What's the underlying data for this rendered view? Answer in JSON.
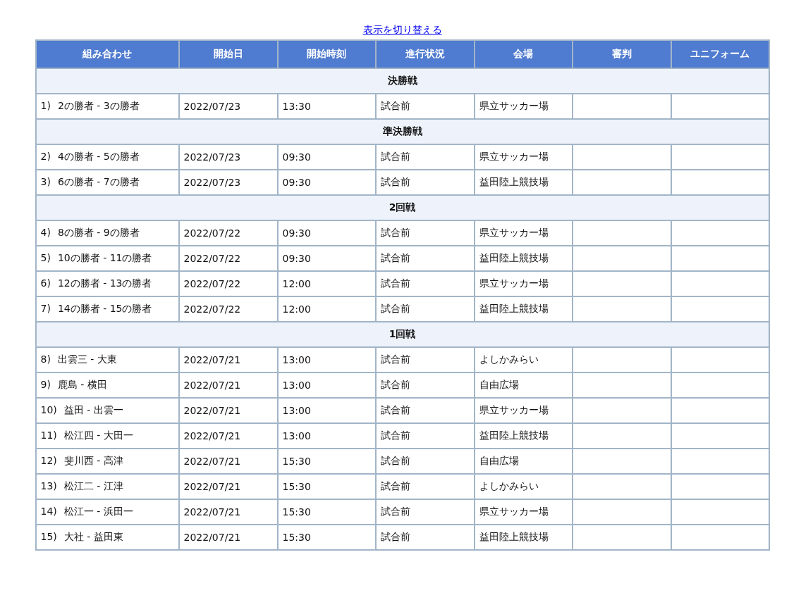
{
  "toggle_link": "表示を切り替える",
  "table": {
    "columns": [
      "組み合わせ",
      "開始日",
      "開始時刻",
      "進行状況",
      "会場",
      "審判",
      "ユニフォーム"
    ],
    "sections": [
      {
        "title": "決勝戦",
        "rows": [
          {
            "no": "1)",
            "match": "2の勝者 - 3の勝者",
            "date": "2022/07/23",
            "time": "13:30",
            "status": "試合前",
            "venue": "県立サッカー場"
          }
        ]
      },
      {
        "title": "準決勝戦",
        "rows": [
          {
            "no": "2)",
            "match": "4の勝者 - 5の勝者",
            "date": "2022/07/23",
            "time": "09:30",
            "status": "試合前",
            "venue": "県立サッカー場"
          },
          {
            "no": "3)",
            "match": "6の勝者 - 7の勝者",
            "date": "2022/07/23",
            "time": "09:30",
            "status": "試合前",
            "venue": "益田陸上競技場"
          }
        ]
      },
      {
        "title": "2回戦",
        "rows": [
          {
            "no": "4)",
            "match": "8の勝者 - 9の勝者",
            "date": "2022/07/22",
            "time": "09:30",
            "status": "試合前",
            "venue": "県立サッカー場"
          },
          {
            "no": "5)",
            "match": "10の勝者 - 11の勝者",
            "date": "2022/07/22",
            "time": "09:30",
            "status": "試合前",
            "venue": "益田陸上競技場"
          },
          {
            "no": "6)",
            "match": "12の勝者 - 13の勝者",
            "date": "2022/07/22",
            "time": "12:00",
            "status": "試合前",
            "venue": "県立サッカー場"
          },
          {
            "no": "7)",
            "match": "14の勝者 - 15の勝者",
            "date": "2022/07/22",
            "time": "12:00",
            "status": "試合前",
            "venue": "益田陸上競技場"
          }
        ]
      },
      {
        "title": "1回戦",
        "rows": [
          {
            "no": "8)",
            "match": "出雲三 - 大東",
            "date": "2022/07/21",
            "time": "13:00",
            "status": "試合前",
            "venue": "よしかみらい"
          },
          {
            "no": "9)",
            "match": "鹿島 - 横田",
            "date": "2022/07/21",
            "time": "13:00",
            "status": "試合前",
            "venue": "自由広場"
          },
          {
            "no": "10)",
            "match": "益田 - 出雲一",
            "date": "2022/07/21",
            "time": "13:00",
            "status": "試合前",
            "venue": "県立サッカー場"
          },
          {
            "no": "11)",
            "match": "松江四 - 大田一",
            "date": "2022/07/21",
            "time": "13:00",
            "status": "試合前",
            "venue": "益田陸上競技場"
          },
          {
            "no": "12)",
            "match": "斐川西 - 高津",
            "date": "2022/07/21",
            "time": "15:30",
            "status": "試合前",
            "venue": "自由広場"
          },
          {
            "no": "13)",
            "match": "松江二 - 江津",
            "date": "2022/07/21",
            "time": "15:30",
            "status": "試合前",
            "venue": "よしかみらい"
          },
          {
            "no": "14)",
            "match": "松江一 - 浜田一",
            "date": "2022/07/21",
            "time": "15:30",
            "status": "試合前",
            "venue": "県立サッカー場"
          },
          {
            "no": "15)",
            "match": "大社 - 益田東",
            "date": "2022/07/21",
            "time": "15:30",
            "status": "試合前",
            "venue": "益田陸上競技場"
          }
        ]
      }
    ]
  }
}
